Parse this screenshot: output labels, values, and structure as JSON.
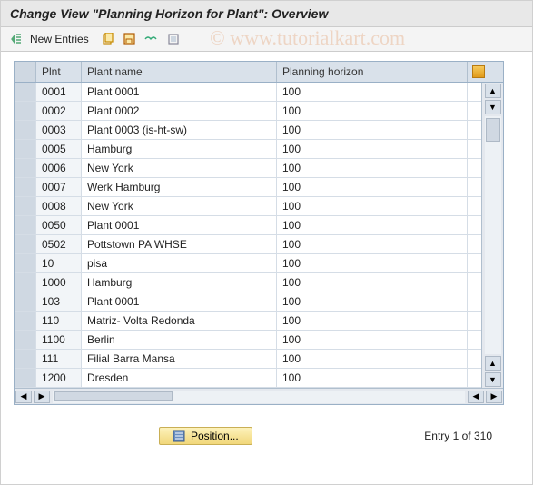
{
  "window": {
    "title": "Change View \"Planning Horizon for Plant\": Overview"
  },
  "watermark": "© www.tutorialkart.com",
  "toolbar": {
    "new_entries_label": "New Entries"
  },
  "table": {
    "columns": {
      "plnt": "Plnt",
      "plant_name": "Plant name",
      "planning_horizon": "Planning horizon"
    },
    "rows": [
      {
        "plnt": "0001",
        "name": "Plant 0001",
        "ph": "100"
      },
      {
        "plnt": "0002",
        "name": "Plant 0002",
        "ph": "100"
      },
      {
        "plnt": "0003",
        "name": "Plant 0003 (is-ht-sw)",
        "ph": "100"
      },
      {
        "plnt": "0005",
        "name": "Hamburg",
        "ph": "100"
      },
      {
        "plnt": "0006",
        "name": "New York",
        "ph": "100"
      },
      {
        "plnt": "0007",
        "name": "Werk Hamburg",
        "ph": "100"
      },
      {
        "plnt": "0008",
        "name": "New York",
        "ph": "100"
      },
      {
        "plnt": "0050",
        "name": "Plant 0001",
        "ph": "100"
      },
      {
        "plnt": "0502",
        "name": "Pottstown PA WHSE",
        "ph": "100"
      },
      {
        "plnt": "10",
        "name": "pisa",
        "ph": "100"
      },
      {
        "plnt": "1000",
        "name": "Hamburg",
        "ph": "100"
      },
      {
        "plnt": "103",
        "name": "Plant 0001",
        "ph": "100"
      },
      {
        "plnt": "110",
        "name": "Matriz- Volta Redonda",
        "ph": "100"
      },
      {
        "plnt": "1100",
        "name": "Berlin",
        "ph": "100"
      },
      {
        "plnt": "111",
        "name": "Filial Barra Mansa",
        "ph": "100"
      },
      {
        "plnt": "1200",
        "name": "Dresden",
        "ph": "100"
      }
    ]
  },
  "footer": {
    "position_label": "Position...",
    "entry_text": "Entry 1 of 310"
  }
}
